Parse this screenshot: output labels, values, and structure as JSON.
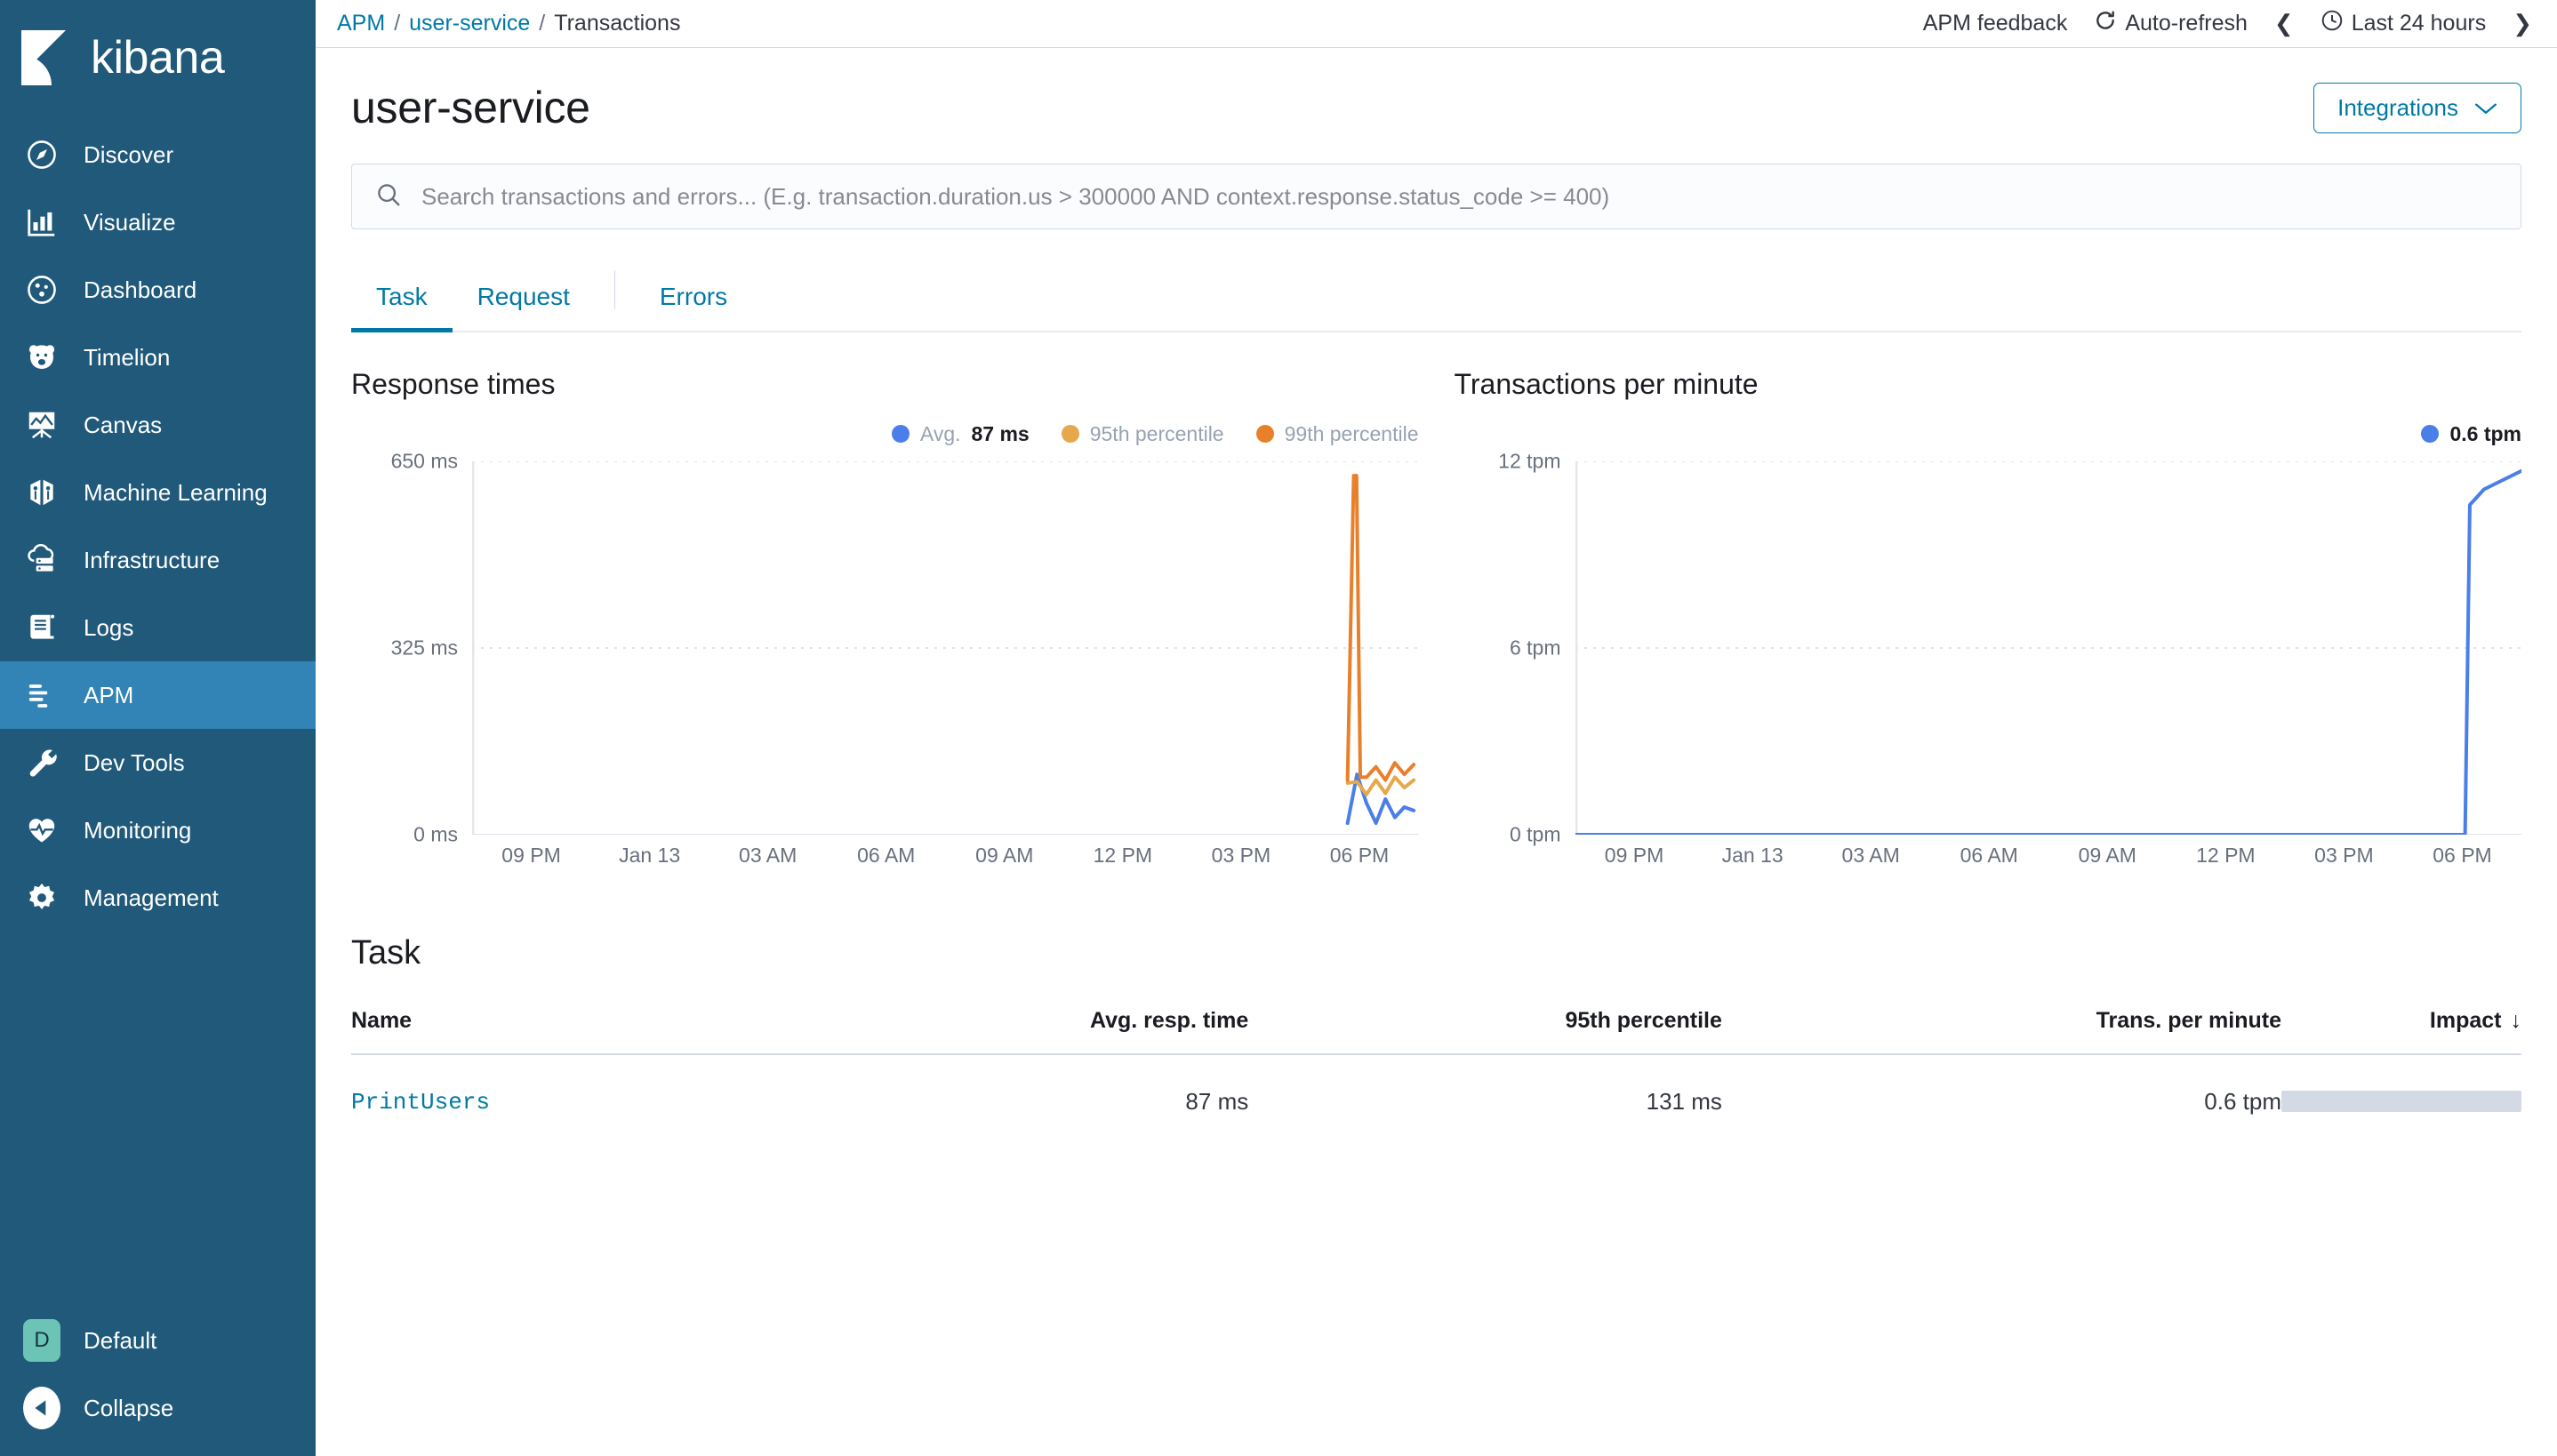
{
  "sidebar": {
    "brand": "kibana",
    "items": [
      {
        "label": "Discover",
        "icon": "compass-icon",
        "active": false
      },
      {
        "label": "Visualize",
        "icon": "bar-chart-icon",
        "active": false
      },
      {
        "label": "Dashboard",
        "icon": "dashboard-icon",
        "active": false
      },
      {
        "label": "Timelion",
        "icon": "bear-icon",
        "active": false
      },
      {
        "label": "Canvas",
        "icon": "easel-icon",
        "active": false
      },
      {
        "label": "Machine Learning",
        "icon": "machine-learning-icon",
        "active": false
      },
      {
        "label": "Infrastructure",
        "icon": "cloud-server-icon",
        "active": false
      },
      {
        "label": "Logs",
        "icon": "scroll-icon",
        "active": false
      },
      {
        "label": "APM",
        "icon": "apm-icon",
        "active": true
      },
      {
        "label": "Dev Tools",
        "icon": "wrench-icon",
        "active": false
      },
      {
        "label": "Monitoring",
        "icon": "heartbeat-icon",
        "active": false
      },
      {
        "label": "Management",
        "icon": "gear-icon",
        "active": false
      }
    ],
    "space": {
      "initial": "D",
      "label": "Default"
    },
    "collapse_label": "Collapse",
    "background_color": "#20597a",
    "active_color": "#3184b5",
    "space_color": "#6bc4b5"
  },
  "topbar": {
    "breadcrumb": [
      {
        "label": "APM",
        "link": true
      },
      {
        "label": "user-service",
        "link": true
      },
      {
        "label": "Transactions",
        "link": false
      }
    ],
    "separator": "/",
    "feedback_label": "APM feedback",
    "auto_refresh_label": "Auto-refresh",
    "time_range_label": "Last 24 hours",
    "prev_arrow": "❮",
    "next_arrow": "❯"
  },
  "header": {
    "title": "user-service",
    "integrations_label": "Integrations"
  },
  "search": {
    "placeholder": "Search transactions and errors... (E.g. transaction.duration.us > 300000 AND context.response.status_code >= 400)",
    "value": ""
  },
  "tabs": [
    {
      "label": "Task",
      "active": true
    },
    {
      "label": "Request",
      "active": false
    },
    {
      "label": "Errors",
      "active": false
    }
  ],
  "chart_data": [
    {
      "type": "line",
      "title": "Response times",
      "xlabel": "",
      "ylabel": "",
      "ylim": [
        0,
        650
      ],
      "yticks": [
        0,
        325,
        650
      ],
      "ytick_labels": [
        "0 ms",
        "325 ms",
        "650 ms"
      ],
      "xtick_labels": [
        "09 PM",
        "Jan 13",
        "03 AM",
        "06 AM",
        "09 AM",
        "12 PM",
        "03 PM",
        "06 PM"
      ],
      "grid": true,
      "legend_position": "top-right",
      "series": [
        {
          "name": "Avg.",
          "legend_value": "87 ms",
          "color": "#4a7ee8",
          "x": [
            0.925,
            0.935,
            0.945,
            0.955,
            0.965,
            0.975,
            0.985,
            0.995
          ],
          "values": [
            20,
            105,
            55,
            20,
            62,
            30,
            48,
            42
          ]
        },
        {
          "name": "95th percentile",
          "color": "#e6a84b",
          "x": [
            0.925,
            0.935,
            0.945,
            0.955,
            0.965,
            0.975,
            0.985,
            0.995
          ],
          "values": [
            90,
            92,
            70,
            95,
            72,
            100,
            82,
            95
          ]
        },
        {
          "name": "99th percentile",
          "color": "#e8802b",
          "x": [
            0.925,
            0.9315,
            0.9345,
            0.9385,
            0.945,
            0.955,
            0.965,
            0.975,
            0.985,
            0.995
          ],
          "values": [
            95,
            625,
            625,
            100,
            100,
            118,
            95,
            125,
            105,
            122
          ]
        }
      ]
    },
    {
      "type": "line",
      "title": "Transactions per minute",
      "xlabel": "",
      "ylabel": "",
      "ylim": [
        0,
        12
      ],
      "yticks": [
        0,
        6,
        12
      ],
      "ytick_labels": [
        "0 tpm",
        "6 tpm",
        "12 tpm"
      ],
      "xtick_labels": [
        "09 PM",
        "Jan 13",
        "03 AM",
        "06 AM",
        "09 AM",
        "12 PM",
        "03 PM",
        "06 PM"
      ],
      "grid": true,
      "legend_position": "top-right",
      "series": [
        {
          "name": "0.6 tpm",
          "legend_value": "0.6 tpm",
          "color": "#4a7ee8",
          "x": [
            0.0,
            0.2,
            0.4,
            0.6,
            0.8,
            0.9,
            0.94,
            0.945,
            0.96,
            0.98,
            1.0
          ],
          "values": [
            0,
            0,
            0,
            0,
            0,
            0,
            0,
            10.6,
            11.1,
            11.4,
            11.7
          ]
        }
      ]
    }
  ],
  "task_section": {
    "title": "Task",
    "columns": [
      {
        "label": "Name",
        "align": "left"
      },
      {
        "label": "Avg. resp. time",
        "align": "right"
      },
      {
        "label": "95th percentile",
        "align": "right"
      },
      {
        "label": "Trans. per minute",
        "align": "right"
      },
      {
        "label": "Impact",
        "align": "right",
        "sort": "desc",
        "sort_glyph": "↓"
      }
    ],
    "rows": [
      {
        "name": "PrintUsers",
        "avg_resp_time": "87 ms",
        "p95": "131 ms",
        "tpm": "0.6 tpm",
        "impact_percent": 100
      }
    ]
  },
  "colors": {
    "link": "#0079a5",
    "text": "#343741",
    "muted": "#69707d",
    "avg": "#4a7ee8",
    "p95": "#e6a84b",
    "p99": "#e8802b"
  }
}
